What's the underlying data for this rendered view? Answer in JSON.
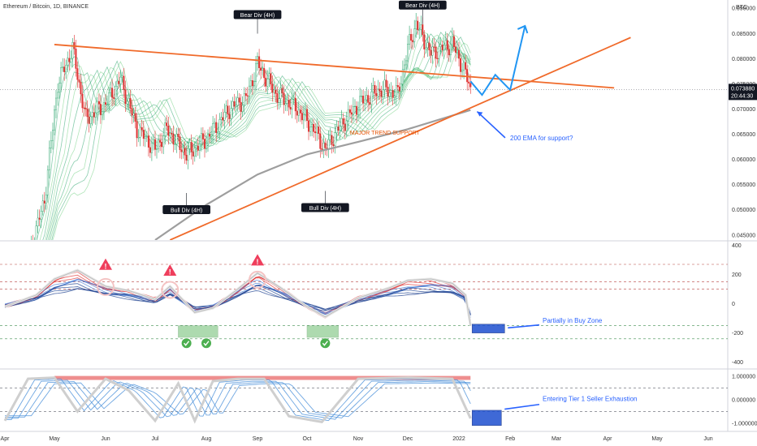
{
  "chart_data": [
    {
      "type": "candlestick",
      "title": "Ethereum / Bitcoin, 1D, BINANCE",
      "currency": "BTC",
      "price": "0.073880",
      "countdown": "20:44:30",
      "ylim": [
        0.044,
        0.091
      ],
      "y_ticks": [
        "0.090000",
        "0.085000",
        "0.080000",
        "0.075000",
        "0.070000",
        "0.065000",
        "0.060000",
        "0.055000",
        "0.050000",
        "0.045000"
      ],
      "y_tick_values": [
        0.09,
        0.085,
        0.08,
        0.075,
        0.07,
        0.065,
        0.06,
        0.055,
        0.05,
        0.045
      ],
      "price_path": [
        {
          "t": "2021-04-01",
          "v": 0.032
        },
        {
          "t": "2021-04-15",
          "v": 0.04
        },
        {
          "t": "2021-04-25",
          "v": 0.052
        },
        {
          "t": "2021-05-03",
          "v": 0.075
        },
        {
          "t": "2021-05-12",
          "v": 0.082
        },
        {
          "t": "2021-05-20",
          "v": 0.068
        },
        {
          "t": "2021-06-01",
          "v": 0.071
        },
        {
          "t": "2021-06-10",
          "v": 0.076
        },
        {
          "t": "2021-06-20",
          "v": 0.066
        },
        {
          "t": "2021-07-01",
          "v": 0.062
        },
        {
          "t": "2021-07-08",
          "v": 0.066
        },
        {
          "t": "2021-07-20",
          "v": 0.061
        },
        {
          "t": "2021-08-01",
          "v": 0.064
        },
        {
          "t": "2021-08-15",
          "v": 0.07
        },
        {
          "t": "2021-08-25",
          "v": 0.072
        },
        {
          "t": "2021-09-01",
          "v": 0.079
        },
        {
          "t": "2021-09-12",
          "v": 0.073
        },
        {
          "t": "2021-09-25",
          "v": 0.07
        },
        {
          "t": "2021-10-05",
          "v": 0.066
        },
        {
          "t": "2021-10-12",
          "v": 0.062
        },
        {
          "t": "2021-10-20",
          "v": 0.066
        },
        {
          "t": "2021-11-01",
          "v": 0.071
        },
        {
          "t": "2021-11-15",
          "v": 0.074
        },
        {
          "t": "2021-11-25",
          "v": 0.073
        },
        {
          "t": "2021-12-01",
          "v": 0.082
        },
        {
          "t": "2021-12-06",
          "v": 0.087
        },
        {
          "t": "2021-12-15",
          "v": 0.081
        },
        {
          "t": "2021-12-28",
          "v": 0.083
        },
        {
          "t": "2022-01-05",
          "v": 0.077
        },
        {
          "t": "2022-01-08",
          "v": 0.07388
        }
      ],
      "ema200": [
        {
          "t": "2021-07-01",
          "v": 0.044
        },
        {
          "t": "2021-08-01",
          "v": 0.051
        },
        {
          "t": "2021-09-01",
          "v": 0.057
        },
        {
          "t": "2021-10-01",
          "v": 0.061
        },
        {
          "t": "2021-11-01",
          "v": 0.0635
        },
        {
          "t": "2021-12-01",
          "v": 0.066
        },
        {
          "t": "2022-01-08",
          "v": 0.0698
        }
      ],
      "projection": [
        {
          "t": "2022-01-08",
          "v": 0.0755
        },
        {
          "t": "2022-01-15",
          "v": 0.0728
        },
        {
          "t": "2022-01-23",
          "v": 0.0768
        },
        {
          "t": "2022-02-01",
          "v": 0.0738
        },
        {
          "t": "2022-02-10",
          "v": 0.0865
        }
      ],
      "trendlines": [
        {
          "from": {
            "t": "2021-05-01",
            "v": 0.0828
          },
          "to": {
            "t": "2022-04-05",
            "v": 0.0742
          }
        },
        {
          "from": {
            "t": "2021-07-10",
            "v": 0.044
          },
          "to": {
            "t": "2022-04-15",
            "v": 0.0842
          }
        }
      ],
      "annotations": [
        {
          "text": "Bear Div (4H)",
          "t": "2021-09-01",
          "v": 0.0885,
          "anchor": "above"
        },
        {
          "text": "Bear Div (4H)",
          "t": "2021-12-10",
          "v": 0.0904,
          "anchor": "above"
        },
        {
          "text": "Bull Div (4H)",
          "t": "2021-07-20",
          "v": 0.0498,
          "anchor": "below"
        },
        {
          "text": "Bull Div (4H)",
          "t": "2021-10-12",
          "v": 0.0502,
          "anchor": "below"
        }
      ],
      "trend_label": "MAJOR TREND SUPPORT",
      "ema_note": "200 EMA for support?"
    },
    {
      "type": "line",
      "name": "oscillator",
      "ylim": [
        -430,
        420
      ],
      "y_ticks": [
        "400",
        "200",
        "0",
        "-200",
        "-400"
      ],
      "y_tick_values": [
        400,
        200,
        0,
        -200,
        -400
      ],
      "dashed_levels": [
        270,
        150,
        100,
        -150,
        -240
      ],
      "main_line": [
        {
          "t": "2021-04-01",
          "v": -20
        },
        {
          "t": "2021-04-20",
          "v": 60
        },
        {
          "t": "2021-05-01",
          "v": 170
        },
        {
          "t": "2021-05-15",
          "v": 230
        },
        {
          "t": "2021-06-01",
          "v": 120
        },
        {
          "t": "2021-06-15",
          "v": 90
        },
        {
          "t": "2021-07-01",
          "v": 30
        },
        {
          "t": "2021-07-10",
          "v": 120
        },
        {
          "t": "2021-07-25",
          "v": -60
        },
        {
          "t": "2021-08-05",
          "v": -30
        },
        {
          "t": "2021-08-20",
          "v": 100
        },
        {
          "t": "2021-09-01",
          "v": 210
        },
        {
          "t": "2021-09-15",
          "v": 110
        },
        {
          "t": "2021-10-01",
          "v": -20
        },
        {
          "t": "2021-10-12",
          "v": -90
        },
        {
          "t": "2021-11-01",
          "v": 40
        },
        {
          "t": "2021-11-20",
          "v": 110
        },
        {
          "t": "2021-12-01",
          "v": 160
        },
        {
          "t": "2021-12-15",
          "v": 170
        },
        {
          "t": "2021-12-28",
          "v": 140
        },
        {
          "t": "2022-01-05",
          "v": 60
        },
        {
          "t": "2022-01-08",
          "v": -150
        }
      ],
      "notes": [
        "Partially in Buy Zone"
      ]
    },
    {
      "type": "line",
      "name": "exhaustion",
      "ylim": [
        -1.25,
        1.25
      ],
      "y_ticks": [
        "1.000000",
        "0.000000",
        "-1.000000"
      ],
      "y_tick_values": [
        1,
        0,
        -1
      ],
      "dashed_levels": [
        0.5,
        -0.5
      ],
      "main_line": [
        {
          "t": "2021-04-01",
          "v": -0.9
        },
        {
          "t": "2021-04-15",
          "v": 0.9
        },
        {
          "t": "2021-05-01",
          "v": 0.95
        },
        {
          "t": "2021-05-15",
          "v": -0.5
        },
        {
          "t": "2021-06-01",
          "v": 0.9
        },
        {
          "t": "2021-06-15",
          "v": 0.4
        },
        {
          "t": "2021-07-01",
          "v": -0.9
        },
        {
          "t": "2021-07-15",
          "v": 0.7
        },
        {
          "t": "2021-07-25",
          "v": -0.9
        },
        {
          "t": "2021-08-05",
          "v": 0.8
        },
        {
          "t": "2021-08-20",
          "v": 0.9
        },
        {
          "t": "2021-09-05",
          "v": 0.9
        },
        {
          "t": "2021-09-20",
          "v": -0.7
        },
        {
          "t": "2021-10-10",
          "v": -0.95
        },
        {
          "t": "2021-11-01",
          "v": 0.9
        },
        {
          "t": "2021-12-01",
          "v": 0.95
        },
        {
          "t": "2021-12-28",
          "v": 0.9
        },
        {
          "t": "2022-01-08",
          "v": -0.8
        }
      ],
      "notes": [
        "Entering Tier 1 Seller Exhaustion"
      ]
    }
  ],
  "x_axis": {
    "labels": [
      {
        "t": "2021-04-01",
        "label": "Apr"
      },
      {
        "t": "2021-05-01",
        "label": "May"
      },
      {
        "t": "2021-06-01",
        "label": "Jun"
      },
      {
        "t": "2021-07-01",
        "label": "Jul"
      },
      {
        "t": "2021-08-01",
        "label": "Aug"
      },
      {
        "t": "2021-09-01",
        "label": "Sep"
      },
      {
        "t": "2021-10-01",
        "label": "Oct"
      },
      {
        "t": "2021-11-01",
        "label": "Nov"
      },
      {
        "t": "2021-12-01",
        "label": "Dec"
      },
      {
        "t": "2022-01-01",
        "label": "2022"
      },
      {
        "t": "2022-02-01",
        "label": "Feb"
      },
      {
        "t": "2022-03-01",
        "label": "Mar"
      },
      {
        "t": "2022-04-01",
        "label": "Apr"
      },
      {
        "t": "2022-05-01",
        "label": "May"
      },
      {
        "t": "2022-06-01",
        "label": "Jun"
      }
    ]
  },
  "colors": {
    "trendline": "#f06a2a",
    "annotation": "#2962ff",
    "bull": "#26a269",
    "bear": "#e03131",
    "ema": "#9e9e9e",
    "buy_zone_box": "#1e4fd0",
    "warning": "#ef3e5c"
  }
}
